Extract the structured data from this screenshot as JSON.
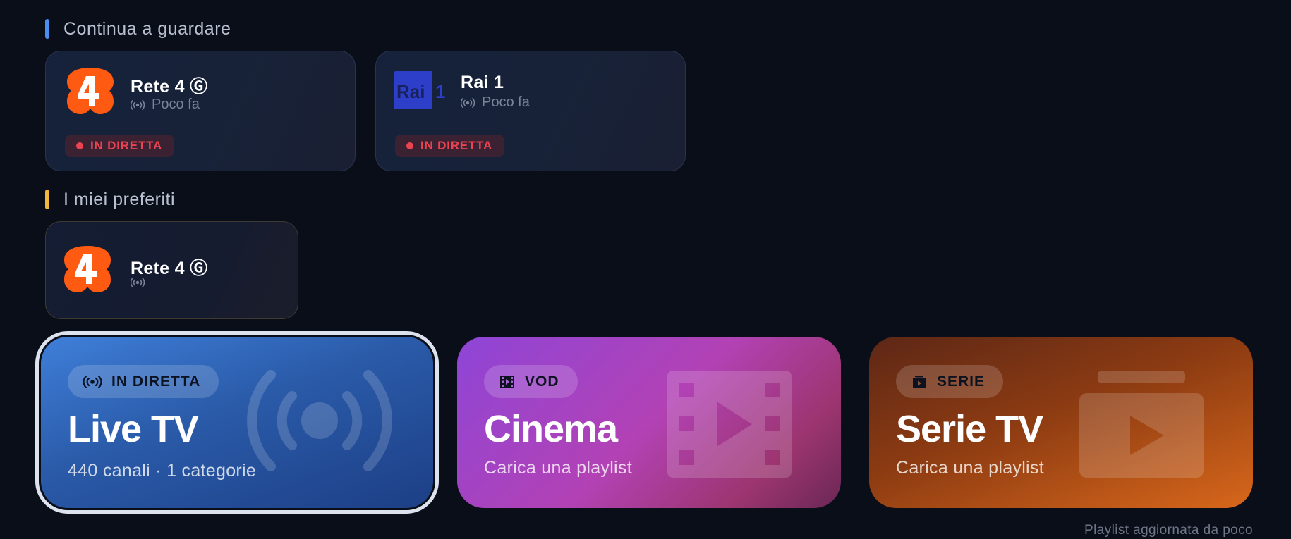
{
  "colors": {
    "continue_accent": "#4b8df0",
    "favorites_accent": "#f4b63c",
    "live_red": "#ec4352",
    "rete4_orange": "#ff5a12",
    "rai_blue": "#2d3fc9"
  },
  "continue_watching": {
    "title": "Continua a guardare",
    "items": [
      {
        "name": "Rete 4 Ⓖ",
        "logo_icon": "rete4-logo",
        "sub_icon": "broadcast-icon",
        "subtitle": "Poco fa",
        "badge": "IN DIRETTA"
      },
      {
        "name": "Rai 1",
        "logo_icon": "rai1-logo",
        "sub_icon": "broadcast-icon",
        "subtitle": "Poco fa",
        "badge": "IN DIRETTA"
      }
    ]
  },
  "favorites": {
    "title": "I miei preferiti",
    "items": [
      {
        "name": "Rete 4 Ⓖ",
        "logo_icon": "rete4-logo",
        "sub_icon": "broadcast-icon"
      }
    ]
  },
  "tiles": {
    "live": {
      "badge": "IN DIRETTA",
      "title": "Live TV",
      "subtitle": "440 canali · 1 categorie",
      "icon": "broadcast-icon"
    },
    "cinema": {
      "badge": "VOD",
      "title": "Cinema",
      "subtitle": "Carica una playlist",
      "icon": "film-icon"
    },
    "serie": {
      "badge": "SERIE",
      "title": "Serie TV",
      "subtitle": "Carica una playlist",
      "icon": "tv-series-icon"
    }
  },
  "footer": {
    "status": "Playlist aggiornata da poco"
  }
}
